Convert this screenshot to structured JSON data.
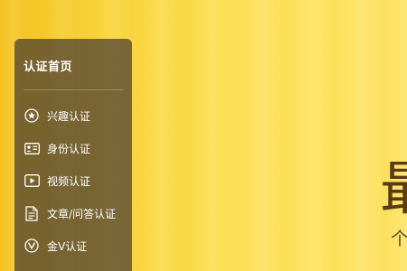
{
  "sidebar": {
    "title": "认证首页",
    "items": [
      {
        "label": "兴趣认证",
        "icon": "star-circle-icon"
      },
      {
        "label": "身份认证",
        "icon": "id-card-icon"
      },
      {
        "label": "视频认证",
        "icon": "video-play-icon"
      },
      {
        "label": "文章/问答认证",
        "icon": "document-icon"
      },
      {
        "label": "金V认证",
        "icon": "v-badge-icon"
      }
    ]
  },
  "hero": {
    "heading_fragment": "最",
    "subtitle_fragment": "个"
  }
}
